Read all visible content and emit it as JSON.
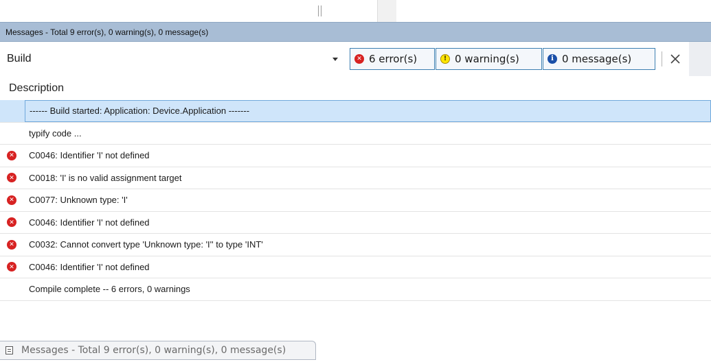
{
  "window": {
    "title": "Messages - Total 9 error(s), 0 warning(s), 0 message(s)"
  },
  "toolbar": {
    "category": "Build",
    "errors_label": "6 error(s)",
    "warnings_label": "0 warning(s)",
    "messages_label": "0 message(s)",
    "clear_icon": "close-icon"
  },
  "table": {
    "column_header": "Description",
    "rows": [
      {
        "icon": "",
        "text": "------ Build started: Application: Device.Application -------",
        "selected": true
      },
      {
        "icon": "",
        "text": "typify code ..."
      },
      {
        "icon": "error-icon",
        "text": "C0046: Identifier 'I' not defined"
      },
      {
        "icon": "error-icon",
        "text": "C0018: 'I' is no valid assignment target"
      },
      {
        "icon": "error-icon",
        "text": "C0077: Unknown type: 'I'"
      },
      {
        "icon": "error-icon",
        "text": "C0046: Identifier 'I' not defined"
      },
      {
        "icon": "error-icon",
        "text": "C0032: Cannot convert type 'Unknown type: 'I'' to type 'INT'"
      },
      {
        "icon": "error-icon",
        "text": "C0046: Identifier 'I' not defined"
      },
      {
        "icon": "",
        "text": "Compile complete -- 6 errors, 0 warnings"
      }
    ]
  },
  "bottom_tab": {
    "label": "Messages - Total 9 error(s), 0 warning(s), 0 message(s)",
    "icon": "messages-list-icon"
  },
  "colors": {
    "title_bar": "#a8bdd5",
    "selection": "#cfe5fa",
    "error": "#d72222",
    "warning": "#ffe600",
    "info": "#1a4fa8",
    "filter_border": "#3c7fb1"
  }
}
